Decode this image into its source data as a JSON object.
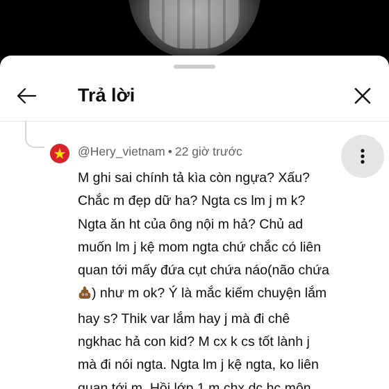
{
  "video": {},
  "header": {
    "title": "Trả lời",
    "back_icon": "arrow-left-icon",
    "close_icon": "close-icon"
  },
  "comment": {
    "author": "@Hery_vietnam",
    "separator": "•",
    "time": "22 giờ trước",
    "avatar_icon": "vietnam-flag-icon",
    "more_icon": "more-vertical-icon",
    "lines": [
      "M ghi sai chính tả kìa còn ngựa? Xấu?",
      "Chắc m đẹp dữ ha? Ngta cs lm j m k?",
      "Ngta ăn ht của ông nội m hả? Chủ ad",
      "muốn lm j kệ mom ngta chứ chắc có liên",
      "quan tới mấy đứa cụt chứa náo(não chứa",
      ") như m ok? Ý là mắc kiếm chuyện lắm",
      "hay s? Thik var lắm hay j mà đi chê",
      "ngkhac hả con kid? M cx k cs tốt lành j",
      "mà đi nói ngta. Ngta lm j kệ ngta, ko liên",
      "quan tới m. Hồi lớp 1 m chx dc hc môn"
    ],
    "emoji_icon": "pile-of-poo-icon"
  },
  "colors": {
    "sheet_bg": "#ffffff",
    "text": "#0f0f0f",
    "meta_text": "#606060",
    "flag_red": "#d8232a",
    "flag_star": "#ffde00"
  }
}
